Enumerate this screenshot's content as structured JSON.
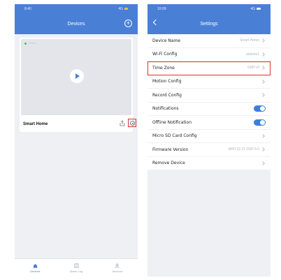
{
  "left": {
    "status": {
      "time": "8:40",
      "signal": "4G"
    },
    "title": "Devices",
    "device": {
      "status": "Online",
      "name": "Smart Home"
    },
    "tabs": [
      {
        "label": "Devices",
        "icon": "home-icon",
        "active": true
      },
      {
        "label": "Alarm Log",
        "icon": "log-icon",
        "active": false
      },
      {
        "label": "Account",
        "icon": "user-icon",
        "active": false
      }
    ]
  },
  "right": {
    "status": {
      "time": "10:09",
      "signal": "4G"
    },
    "title": "Settings",
    "rows": [
      {
        "label": "Device Name",
        "value": "Smart Home",
        "type": "chevron"
      },
      {
        "label": "Wi-Fi Config",
        "value": "aistone1",
        "type": "chevron"
      },
      {
        "label": "Time Zone",
        "value": "GMT+8",
        "type": "chevron",
        "highlight": true
      },
      {
        "label": "Motion Config",
        "value": "",
        "type": "chevron"
      },
      {
        "label": "Record Config",
        "value": "",
        "type": "chevron"
      },
      {
        "label": "Notifications",
        "value": "",
        "type": "toggle",
        "on": true
      },
      {
        "label": "Offline Notification",
        "value": "",
        "type": "toggle",
        "on": true
      },
      {
        "label": "Micro SD Card Config",
        "value": "",
        "type": "chevron"
      },
      {
        "label": "Firmware Version",
        "value": "WIFI:22.21 DSP:3.9",
        "type": "chevron"
      },
      {
        "label": "Remove Device",
        "value": "",
        "type": "chevron"
      }
    ]
  },
  "colors": {
    "accent": "#4a7fd6",
    "highlight": "#e03030",
    "online": "#3cc34a",
    "toggle_on": "#3a7fe0"
  }
}
